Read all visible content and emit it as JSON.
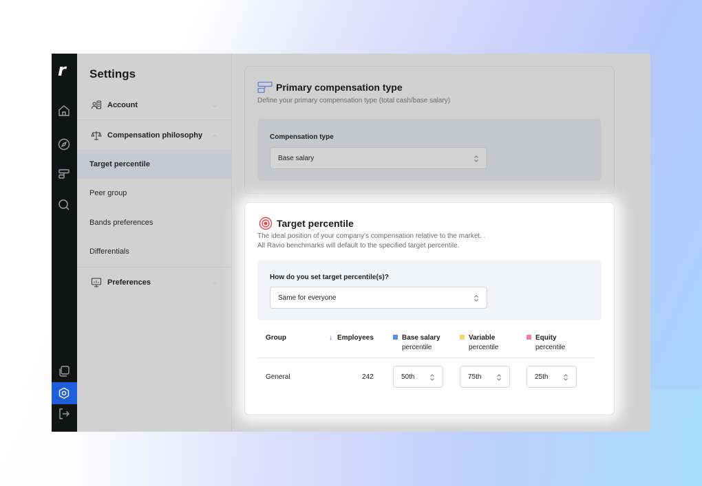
{
  "app": {
    "logo": "r"
  },
  "rail": {
    "icons": [
      "home-icon",
      "compass-icon",
      "bands-icon",
      "search-icon",
      "copy-icon",
      "settings-icon",
      "logout-icon"
    ],
    "active": "settings-icon",
    "active_color": "#1f5edb"
  },
  "settings": {
    "title": "Settings",
    "groups": [
      {
        "label": "Account",
        "icon": "account-icon",
        "expanded": false
      },
      {
        "label": "Compensation philosophy",
        "icon": "scale-icon",
        "expanded": true
      },
      {
        "label": "Preferences",
        "icon": "presentation-icon",
        "expanded": false
      }
    ],
    "sub_items": [
      {
        "label": "Target percentile",
        "active": true
      },
      {
        "label": "Peer group",
        "active": false
      },
      {
        "label": "Bands preferences",
        "active": false
      },
      {
        "label": "Differentials",
        "active": false
      }
    ]
  },
  "primary_card": {
    "title": "Primary compensation type",
    "subtitle": "Define your primary compensation type (total cash/base salary)",
    "field_label": "Compensation type",
    "selected": "Base salary"
  },
  "target_card": {
    "title": "Target percentile",
    "subtitle_line1": "The ideal position of your company's compensation relative to the market. .",
    "subtitle_line2": "All Ravio benchmarks will default to the specified target percentile.",
    "field_label": "How do you set target percentile(s)?",
    "selected": "Same for everyone",
    "table": {
      "headers": {
        "group": "Group",
        "employees": "Employees",
        "base_title": "Base salary",
        "base_sub": "percentile",
        "variable_title": "Variable",
        "variable_sub": "percentile",
        "equity_title": "Equity",
        "equity_sub": "percentile"
      },
      "legend_colors": {
        "base": "#5b8def",
        "variable": "#f5d46b",
        "equity": "#ee7fa3"
      },
      "rows": [
        {
          "group": "General",
          "employees": "242",
          "base": "50th",
          "variable": "75th",
          "equity": "25th"
        }
      ]
    }
  }
}
